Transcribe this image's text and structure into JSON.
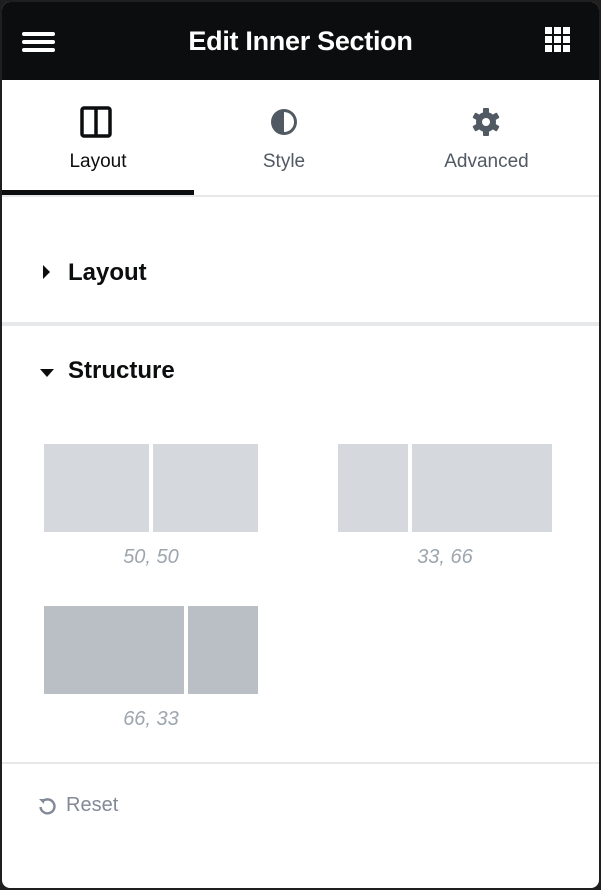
{
  "header": {
    "title": "Edit Inner Section",
    "menu_icon": "hamburger-menu-icon",
    "apps_icon": "grid-apps-icon"
  },
  "tabs": [
    {
      "label": "Layout",
      "icon": "columns-layout-icon",
      "active": true
    },
    {
      "label": "Style",
      "icon": "half-circle-contrast-icon",
      "active": false
    },
    {
      "label": "Advanced",
      "icon": "gear-icon",
      "active": false
    }
  ],
  "sections": {
    "layout": {
      "label": "Layout",
      "expanded": false
    },
    "structure": {
      "label": "Structure",
      "expanded": true
    }
  },
  "structure_options": [
    {
      "label": "50, 50",
      "columns": [
        50,
        50
      ],
      "selected": false
    },
    {
      "label": "33, 66",
      "columns": [
        33,
        66
      ],
      "selected": false
    },
    {
      "label": "66, 33",
      "columns": [
        66,
        33
      ],
      "selected": true
    }
  ],
  "footer": {
    "reset_label": "Reset",
    "reset_icon": "undo-icon"
  },
  "colors": {
    "header_bg": "#0c0d0e",
    "tab_active": "#0c0d0e",
    "tab_inactive": "#515962",
    "structure_option": "#d5d8dc",
    "structure_option_selected": "#babfc5",
    "caption": "#9da5ae",
    "reset": "#818a96"
  }
}
